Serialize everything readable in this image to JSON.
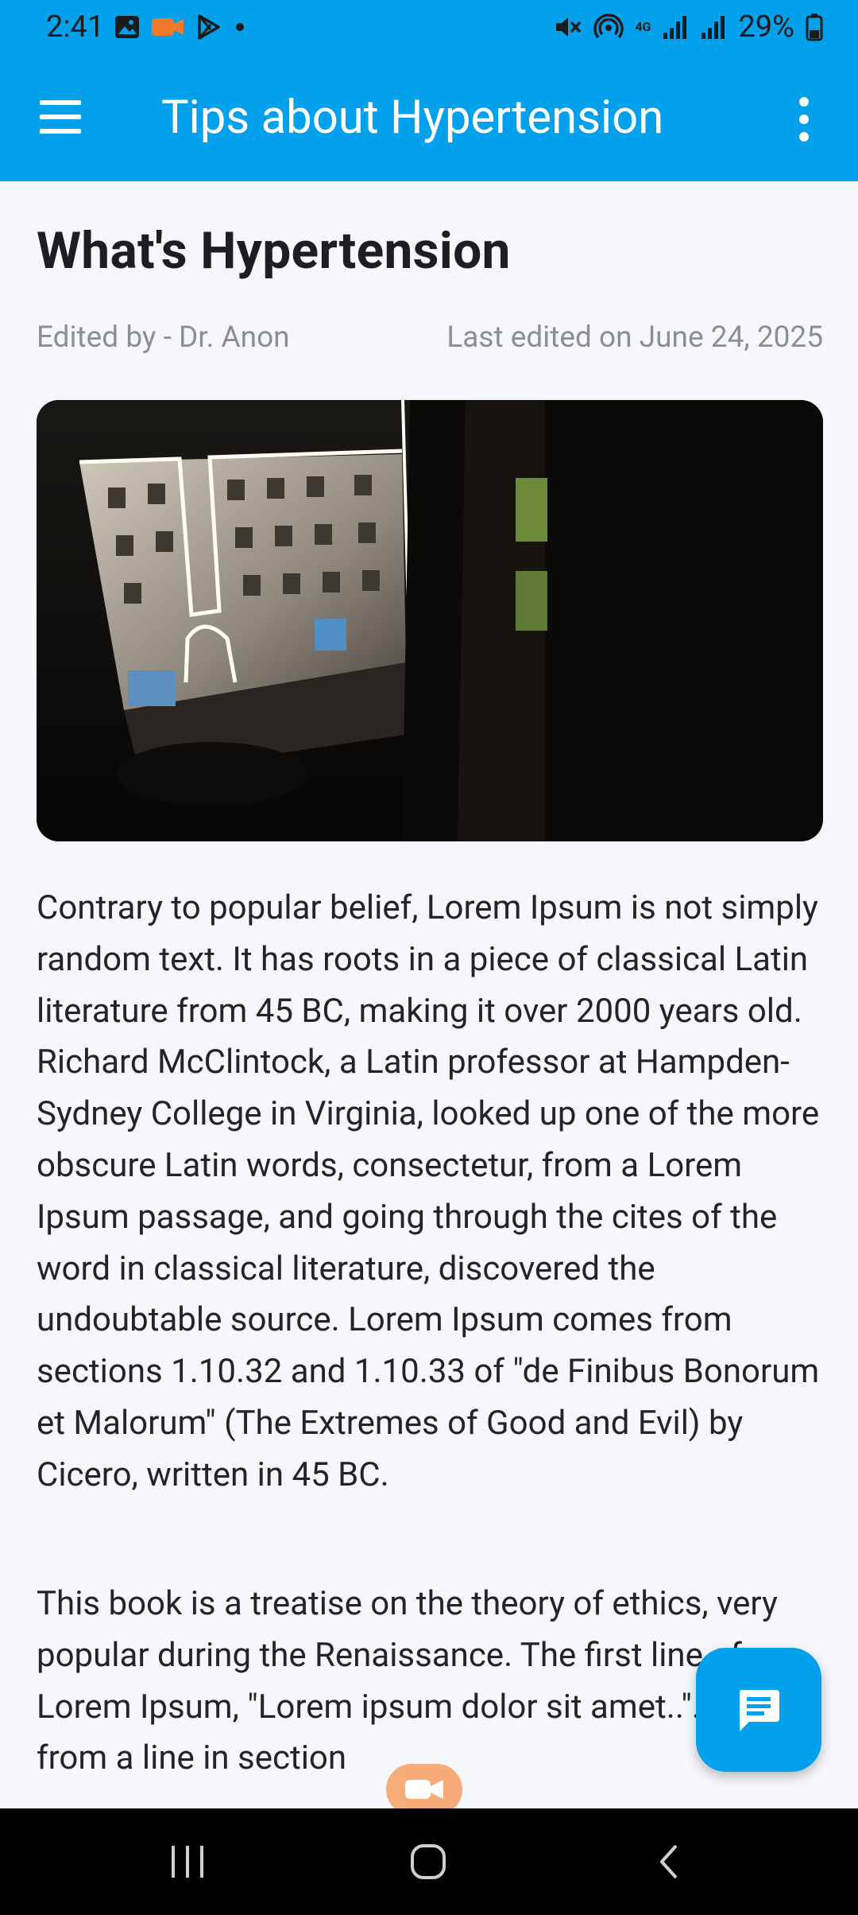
{
  "status_bar": {
    "time": "2:41",
    "battery": "29%",
    "network": "4G",
    "icons": [
      "gallery-icon",
      "screen-record-icon",
      "play-store-icon",
      "dot-icon",
      "mute-icon",
      "hotspot-icon",
      "signal-icon",
      "signal-icon",
      "battery-icon"
    ]
  },
  "app_bar": {
    "title": "Tips about Hypertension",
    "menu_icon": "hamburger-menu-icon",
    "more_icon": "more-vertical-icon"
  },
  "article": {
    "title": "What's Hypertension",
    "editor": "Edited by - Dr. Anon",
    "last_edited": "Last edited on June 24, 2025",
    "image": "night-building-photo",
    "paragraphs": [
      "Contrary to popular belief, Lorem Ipsum is not simply random text. It has roots in a piece of classical Latin literature from 45 BC, making it over 2000 years old. Richard McClintock, a Latin professor at Hampden-Sydney College in Virginia, looked up one of the more obscure Latin words, consectetur, from a Lorem Ipsum passage, and going through the cites of the word in classical literature, discovered the undoubtable source. Lorem Ipsum comes from sections 1.10.32 and 1.10.33 of \"de Finibus Bonorum et Malorum\" (The Extremes of Good and Evil) by Cicero, written in 45 BC.",
      "This book is a treatise on the theory of ethics, very popular during the Renaissance. The first line of Lorem Ipsum, \"Lorem ipsum dolor sit amet..\". comes from a line in section"
    ]
  },
  "fab": {
    "icon": "chat-icon"
  },
  "nav_bar": {
    "buttons": [
      "recent-apps-icon",
      "home-icon",
      "back-icon"
    ]
  },
  "colors": {
    "primary": "#03a1ec",
    "background": "#f6f7fa",
    "meta_text": "#8b8f94"
  }
}
